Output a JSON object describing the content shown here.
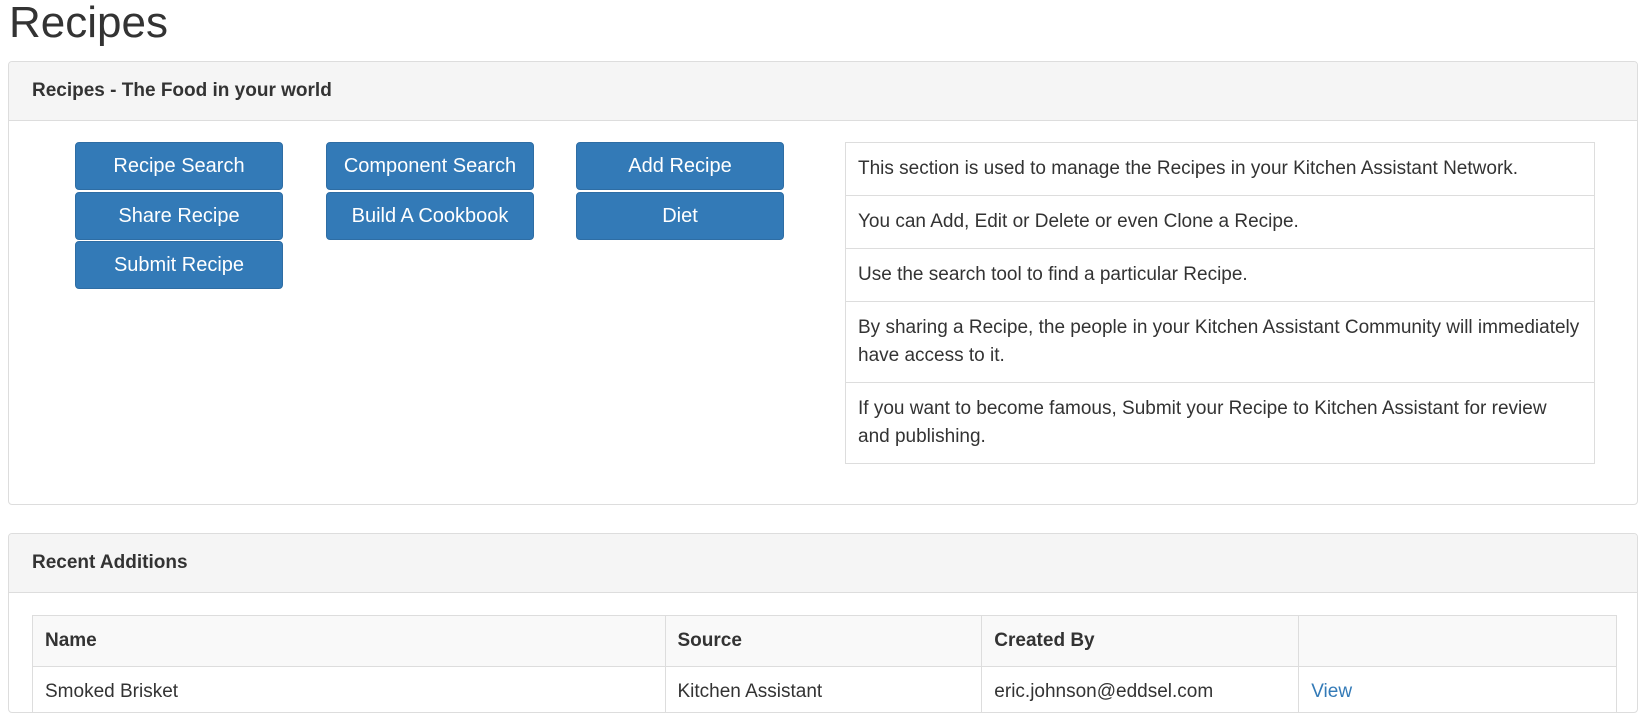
{
  "page": {
    "title": "Recipes"
  },
  "recipes_panel": {
    "heading": "Recipes - The Food in your world",
    "buttons": {
      "recipe_search": "Recipe Search",
      "share_recipe": "Share Recipe",
      "submit_recipe": "Submit Recipe",
      "component_search": "Component Search",
      "build_cookbook": "Build A Cookbook",
      "add_recipe": "Add Recipe",
      "diet": "Diet"
    },
    "info": [
      "This section is used to manage the Recipes in your Kitchen Assistant Network.",
      "You can Add, Edit or Delete or even Clone a Recipe.",
      "Use the search tool to find a particular Recipe.",
      "By sharing a Recipe, the people in your Kitchen Assistant Community will immediately have access to it.",
      "If you want to become famous, Submit your Recipe to Kitchen Assistant for review and publishing."
    ]
  },
  "recent_panel": {
    "heading": "Recent Additions",
    "columns": [
      "Name",
      "Source",
      "Created By",
      ""
    ],
    "rows": [
      {
        "name": "Smoked Brisket",
        "source": "Kitchen Assistant",
        "created_by": "eric.johnson@eddsel.com",
        "action": "View"
      }
    ]
  },
  "colors": {
    "primary": "#337ab7",
    "panel_heading_bg": "#f5f5f5",
    "border": "#dddddd"
  }
}
